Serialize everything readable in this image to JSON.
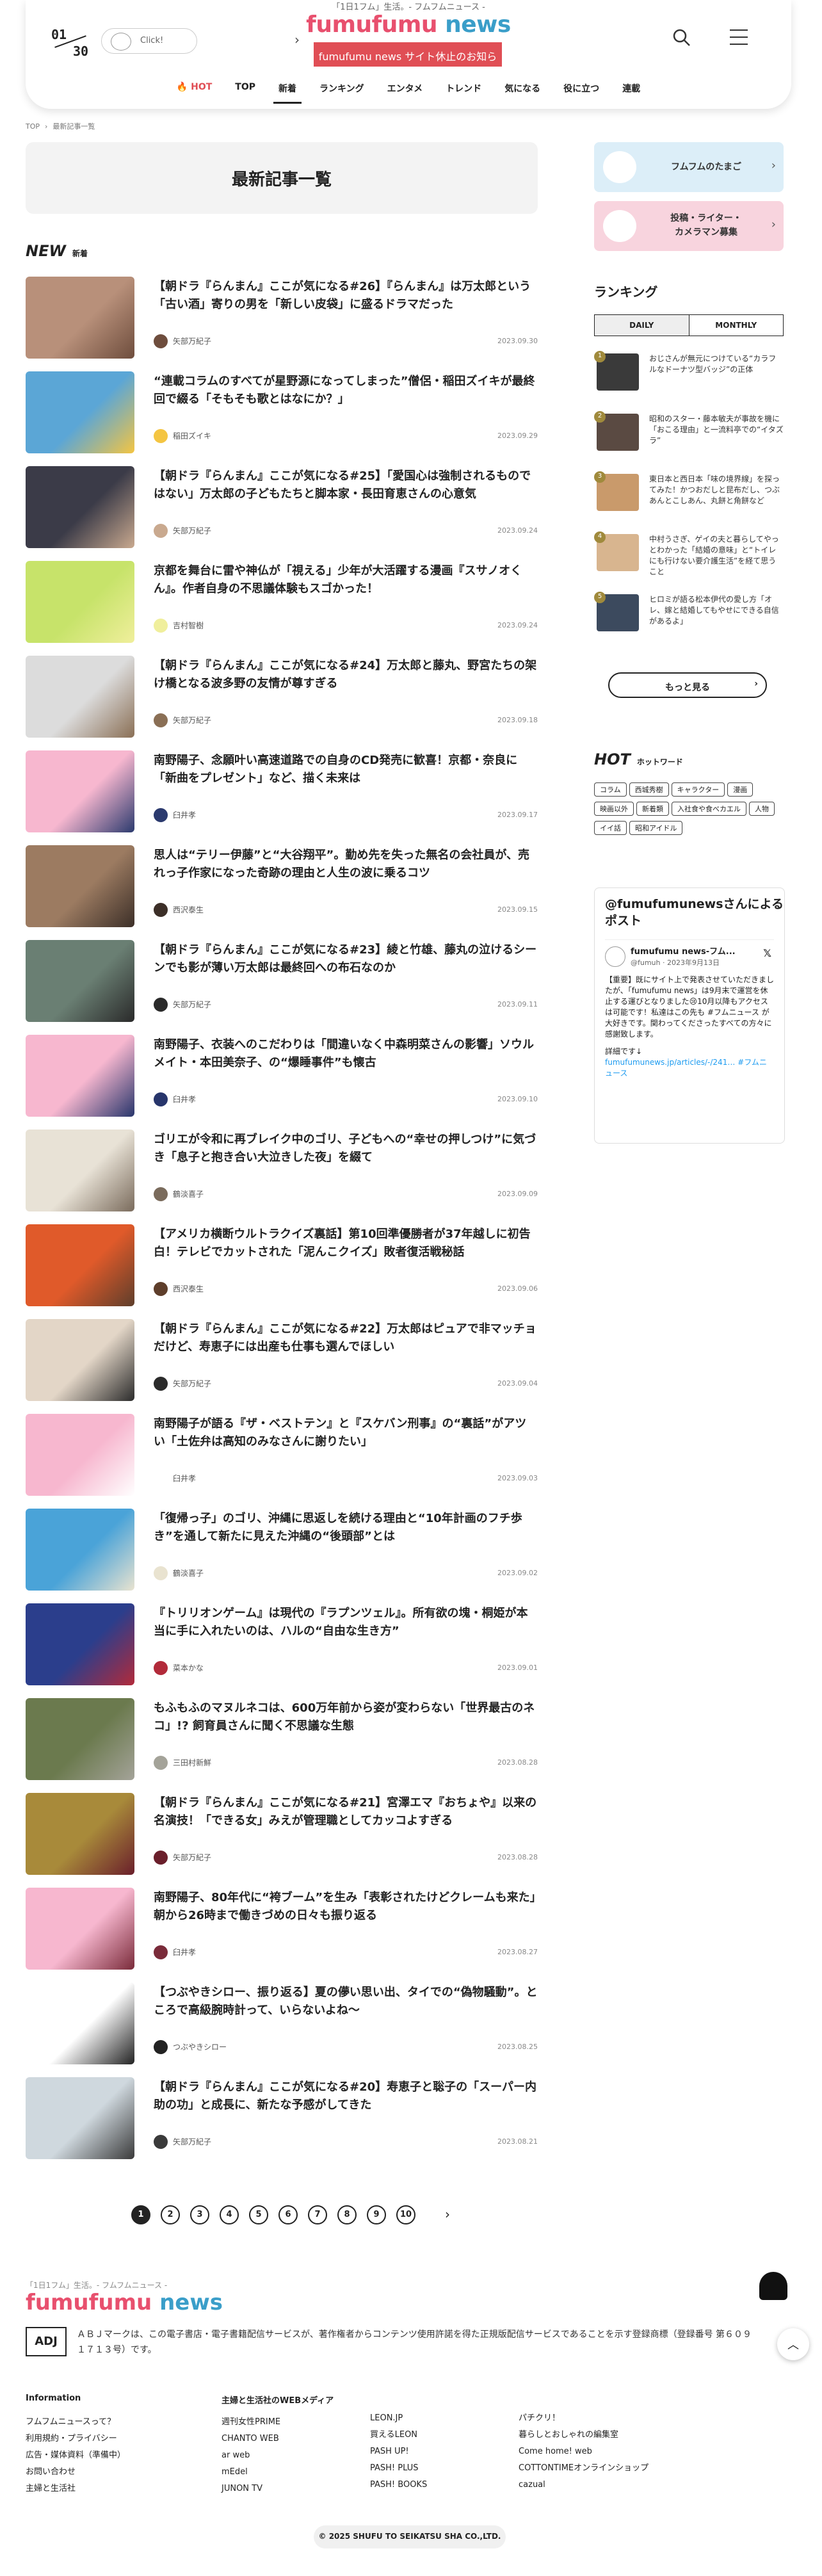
{
  "header": {
    "tagline": "「1日1フム」生活。- フムフムニュース -",
    "logo1": "fumufumu",
    "logo2": " news",
    "notice": "fumufumu news サイト休止のお知らせ",
    "date_month": "01",
    "date_day": "30",
    "click": "Click!",
    "nav": [
      "🔥 HOT",
      "TOP",
      "新着",
      "ランキング",
      "エンタメ",
      "トレンド",
      "気になる",
      "役に立つ",
      "連載"
    ]
  },
  "breadcrumb": [
    "TOP",
    "最新記事一覧"
  ],
  "page_title": "最新記事一覧",
  "new_heading": "NEW",
  "new_sub": "新着",
  "articles": [
    {
      "title": "【朝ドラ『らんまん』ここが気になる#26】『らんまん』は万太郎という「古い酒」寄りの男を「新しい皮袋」に盛るドラマだった",
      "author": "矢部万紀子",
      "date": "2023.09.30",
      "c1": "#b8907a",
      "c2": "#6e4d3d"
    },
    {
      "title": "“連載コラムのすべてが星野源になってしまった”僧侶・稲田ズイキが最終回で綴る「そもそも歌とはなにか？」",
      "author": "稲田ズイキ",
      "date": "2023.09.29",
      "c1": "#5ba6d6",
      "c2": "#f4c542"
    },
    {
      "title": "【朝ドラ『らんまん』ここが気になる#25】「愛国心は強制されるものではない」万太郎の子どもたちと脚本家・長田育恵さんの心意気",
      "author": "矢部万紀子",
      "date": "2023.09.24",
      "c1": "#3b3b48",
      "c2": "#c9a98f"
    },
    {
      "title": "京都を舞台に雷や神仏が「視える」少年が大活躍する漫画『スサノオくん』。作者自身の不思議体験もスゴかった！",
      "author": "吉村智樹",
      "date": "2023.09.24",
      "c1": "#c7e36a",
      "c2": "#f0ef9c"
    },
    {
      "title": "【朝ドラ『らんまん』ここが気になる#24】万太郎と藤丸、野宮たちの架け橋となる波多野の友情が尊すぎる",
      "author": "矢部万紀子",
      "date": "2023.09.18",
      "c1": "#dcdcdc",
      "c2": "#8a6f55"
    },
    {
      "title": "南野陽子、念願叶い高速道路での自身のCD発売に歓喜！京都・奈良に「新曲をプレゼント」など、描く未来は",
      "author": "臼井孝",
      "date": "2023.09.17",
      "c1": "#f7b7cf",
      "c2": "#2b3a6e"
    },
    {
      "title": "思人は“テリー伊藤”と“大谷翔平”。勤め先を失った無名の会社員が、売れっ子作家になった奇跡の理由と人生の波に乗るコツ",
      "author": "西沢泰生",
      "date": "2023.09.15",
      "c1": "#9c7b61",
      "c2": "#3c2f28"
    },
    {
      "title": "【朝ドラ『らんまん』ここが気になる#23】綾と竹雄、藤丸の泣けるシーンでも影が薄い万太郎は最終回への布石なのか",
      "author": "矢部万紀子",
      "date": "2023.09.11",
      "c1": "#6a7f73",
      "c2": "#2a2a2a"
    },
    {
      "title": "南野陽子、衣装へのこだわりは「間違いなく中森明菜さんの影響」ソウルメイト・本田美奈子、の“爆睡事件”も懐古",
      "author": "臼井孝",
      "date": "2023.09.10",
      "c1": "#f7b7cf",
      "c2": "#27356b"
    },
    {
      "title": "ゴリエが令和に再ブレイク中のゴリ、子どもへの“幸せの押しつけ”に気づき「息子と抱き合い大泣きした夜」を綴て",
      "author": "鶴淡喜子",
      "date": "2023.09.09",
      "c1": "#e8e2d6",
      "c2": "#7a6b5c"
    },
    {
      "title": "【アメリカ横断ウルトラクイズ裏話】第10回準優勝者が37年越しに初告白！テレビでカットされた「泥んこクイズ」敗者復活戦秘話",
      "author": "西沢泰生",
      "date": "2023.09.06",
      "c1": "#e05a2a",
      "c2": "#5e3e2b"
    },
    {
      "title": "【朝ドラ『らんまん』ここが気になる#22】万太郎はピュアで非マッチョだけど、寿恵子には出産も仕事も選んでほしい",
      "author": "矢部万紀子",
      "date": "2023.09.04",
      "c1": "#e3d6c7",
      "c2": "#2b2b2b"
    },
    {
      "title": "南野陽子が語る『ザ・ベストテン』と『スケバン刑事』の“裏話”がアツい「土佐弁は高知のみなさんに謝りたい」",
      "author": "臼井孝",
      "date": "2023.09.03",
      "c1": "#f7b7cf",
      "c2": "#ffffff"
    },
    {
      "title": "「復帰っ子」のゴリ、沖縄に思返しを続ける理由と“10年計画のフチ歩き”を通して新たに見えた沖縄の“後頭部”とは",
      "author": "鶴淡喜子",
      "date": "2023.09.02",
      "c1": "#4aa3d8",
      "c2": "#e9e3d0"
    },
    {
      "title": "『トリリオンゲーム』は現代の『ラプンツェル』。所有欲の塊・桐姫が本当に手に入れたいのは、ハルの“自由な生き方”",
      "author": "菜本かな",
      "date": "2023.09.01",
      "c1": "#2b3e8c",
      "c2": "#b22a3a"
    },
    {
      "title": "もふもふのマヌルネコは、600万年前から姿が変わらない「世界最古のネコ」!? 飼育員さんに聞く不思議な生態",
      "author": "三田村新鮮",
      "date": "2023.08.28",
      "c1": "#6b7a4e",
      "c2": "#a4a399"
    },
    {
      "title": "【朝ドラ『らんまん』ここが気になる#21】宮澤エマ『おちょや』以来の名演技！「できる女」みえが管理職としてカッコよすぎる",
      "author": "矢部万紀子",
      "date": "2023.08.28",
      "c1": "#a88a3a",
      "c2": "#6a1f2b"
    },
    {
      "title": "南野陽子、80年代に“袴ブーム”を生み「表彰されたけどクレームも来た」朝から26時まで働きづめの日々も振り返る",
      "author": "臼井孝",
      "date": "2023.08.27",
      "c1": "#f7b7cf",
      "c2": "#7a2b3a"
    },
    {
      "title": "【つぶやきシロー、振り返る】夏の儚い思い出、タイでの“偽物騒動”。ところで高級腕時計って、いらないよね〜",
      "author": "つぶやきシロー",
      "date": "2023.08.25",
      "c1": "#ffffff",
      "c2": "#222222"
    },
    {
      "title": "【朝ドラ『らんまん』ここが気になる#20】寿恵子と聡子の「スーパー内助の功」と成長に、新たな予感がしてきた",
      "author": "矢部万紀子",
      "date": "2023.08.21",
      "c1": "#cfd8de",
      "c2": "#3a3a3a"
    }
  ],
  "pagination": [
    "1",
    "2",
    "3",
    "4",
    "5",
    "6",
    "7",
    "8",
    "9",
    "10"
  ],
  "sidebar": {
    "banner1": "フムフムのたまご",
    "banner2": "投稿・ライター・\nカメラマン募集",
    "ranking_title": "ランキング",
    "tab_daily": "DAILY",
    "tab_monthly": "MONTHLY",
    "ranking": [
      {
        "n": "1",
        "t": "おじさんが無元につけている“カラフルなドーナツ型バッジ”の正体",
        "c": "#3a3a3a"
      },
      {
        "n": "2",
        "t": "昭和のスター・藤本敏夫が事故を機に「おこる理由」と一流料亭での“イタズラ”",
        "c": "#5a4a42"
      },
      {
        "n": "3",
        "t": "東日本と西日本「味の境界線」を探ってみた！かつおだしと昆布だし、つぶあんとこしあん、丸餅と角餅など",
        "c": "#c99a6b"
      },
      {
        "n": "4",
        "t": "中村うさぎ、ゲイの夫と暮らしてやっとわかった「結婚の意味」と“トイレにも行けない要介護生活”を経て思うこと",
        "c": "#d8b58f"
      },
      {
        "n": "5",
        "t": "ヒロミが語る松本伊代の愛し方「オレ、嫁と結婚してもやせにできる自信があるよ」",
        "c": "#3c4a5e"
      }
    ],
    "more": "もっと見る",
    "hot_title": "HOT",
    "hot_sub": "ホットワード",
    "hot_tags": [
      "コラム",
      "西城秀樹",
      "キャラクター",
      "漫画",
      "映画以外",
      "新着類",
      "入社食や食べカエル",
      "人物",
      "イイ話",
      "昭和アイドル"
    ],
    "tw_title": "@fumufumunewsさんによるポスト",
    "tw_name": "fumufumu news-フム...",
    "tw_handle": "@fumuh · 2023年9月13日",
    "tw_body": "【重要】既にサイト上で発表させていただきましたが、「fumufumu news」は9月末で運営を休止する運びとなりました😢10月以降もアクセスは可能です！私達はこの先も #フムニュース が大好きです。関わってくださったすべての方々に感謝致します。",
    "tw_more": "詳細です↓",
    "tw_link": "fumufumunews.jp/articles/-/241… #フムニュース"
  },
  "footer": {
    "tagline": "「1日1フム」生活。- フムフムニュース -",
    "logo1": "fumufumu",
    "logo2": " news",
    "adj": "ADJ",
    "adj_text": "ＡＢＪマークは、この電子書店・電子書籍配信サービスが、著作権者からコンテンツ使用許諾を得た正規版配信サービスであることを示す登録商標（登録番号 第６０９１７１３号）です。",
    "info_h": "Information",
    "info": [
      "フムフムニュースって？",
      "利用規約・プライバシー",
      "広告・媒体資料（準備中）",
      "お問い合わせ",
      "主婦と生活社"
    ],
    "media_h": "主婦と生活社のWEBメディア",
    "media1": [
      "週刊女性PRIME",
      "CHANTO WEB",
      "ar web",
      "mEdel",
      "JUNON TV"
    ],
    "media2": [
      "LEON.JP",
      "買えるLEON",
      "PASH UP!",
      "PASH! PLUS",
      "PASH! BOOKS"
    ],
    "media3": [
      "パチクリ！",
      "暮らしとおしゃれの編集室",
      "Come home! web",
      "COTTONTIMEオンラインショップ",
      "cazual"
    ],
    "copyright": "© 2025 SHUFU TO SEIKATSU SHA CO.,LTD."
  }
}
